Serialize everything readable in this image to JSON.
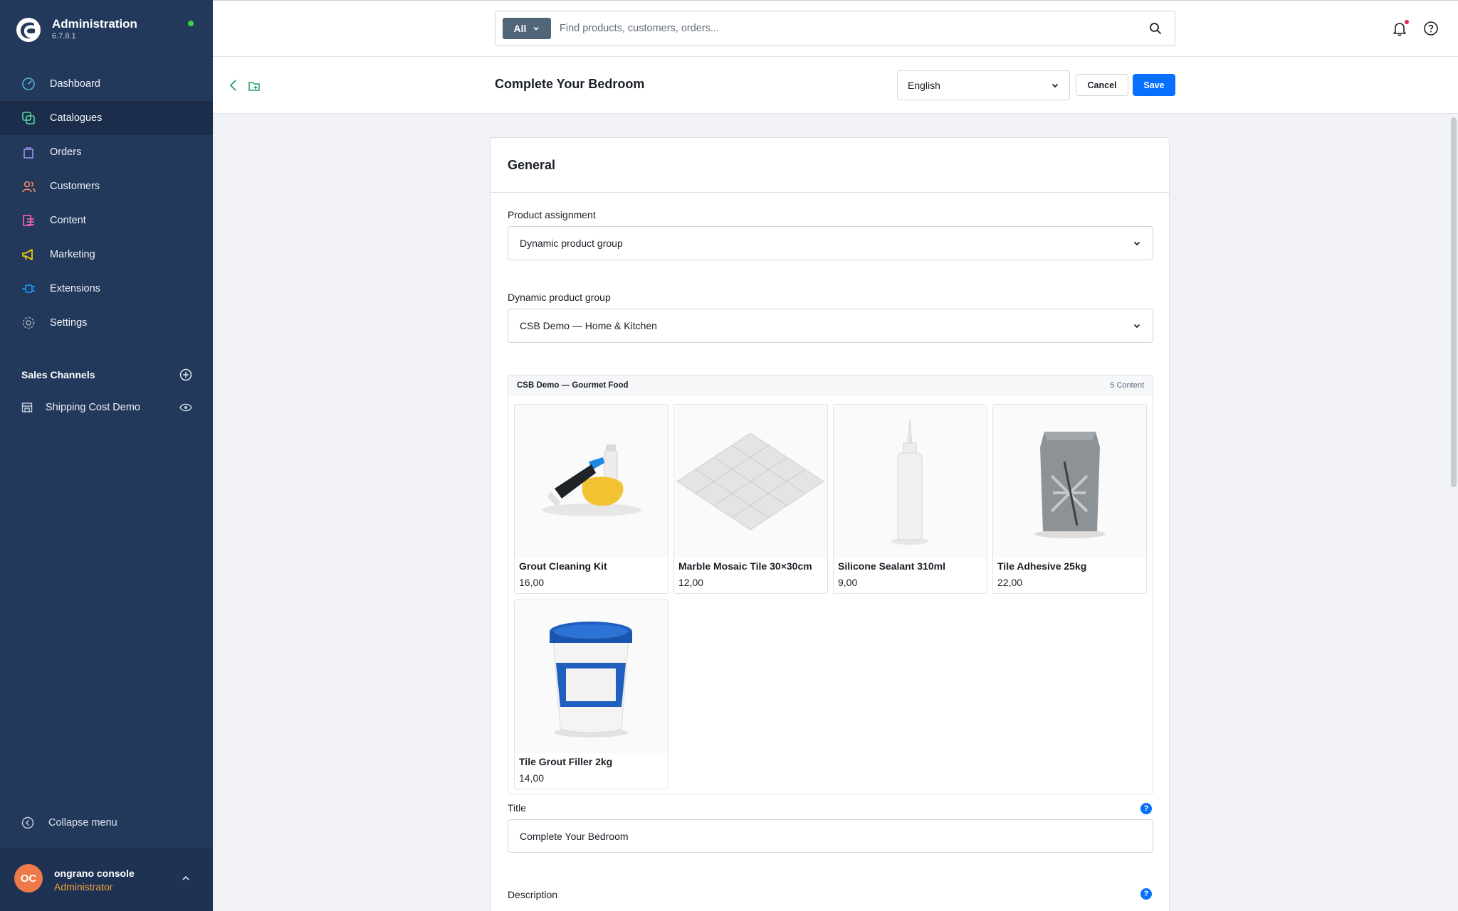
{
  "app": {
    "title": "Administration",
    "version": "6.7.8.1"
  },
  "nav": [
    {
      "label": "Dashboard",
      "icon": "dashboard-icon",
      "color": "#56b3d9"
    },
    {
      "label": "Catalogues",
      "icon": "catalogues-icon",
      "color": "#57d9a3",
      "active": true
    },
    {
      "label": "Orders",
      "icon": "orders-icon",
      "color": "#a092f0"
    },
    {
      "label": "Customers",
      "icon": "customers-icon",
      "color": "#f88962"
    },
    {
      "label": "Content",
      "icon": "content-icon",
      "color": "#ff68b4"
    },
    {
      "label": "Marketing",
      "icon": "marketing-icon",
      "color": "#ffd700"
    },
    {
      "label": "Extensions",
      "icon": "extensions-icon",
      "color": "#189eff"
    },
    {
      "label": "Settings",
      "icon": "settings-icon",
      "color": "#9aa8b5"
    }
  ],
  "sales_channels": {
    "heading": "Sales Channels",
    "items": [
      {
        "label": "Shipping Cost Demo"
      }
    ]
  },
  "collapse_label": "Collapse menu",
  "user": {
    "initials": "OC",
    "name": "ongrano console",
    "role": "Administrator"
  },
  "search": {
    "type_label": "All",
    "placeholder": "Find products, customers, orders..."
  },
  "smartbar": {
    "title": "Complete Your Bedroom",
    "language": "English",
    "cancel_label": "Cancel",
    "save_label": "Save"
  },
  "card": {
    "title": "General",
    "product_assignment": {
      "label": "Product assignment",
      "value": "Dynamic product group"
    },
    "dynamic_group": {
      "label": "Dynamic product group",
      "value": "CSB Demo — Home & Kitchen"
    },
    "preview": {
      "title": "CSB Demo — Gourmet Food",
      "count": "5 Content",
      "products": [
        {
          "name": "Grout Cleaning Kit",
          "price": "16,00"
        },
        {
          "name": "Marble Mosaic Tile 30×30cm",
          "price": "12,00"
        },
        {
          "name": "Silicone Sealant 310ml",
          "price": "9,00"
        },
        {
          "name": "Tile Adhesive 25kg",
          "price": "22,00"
        },
        {
          "name": "Tile Grout Filler 2kg",
          "price": "14,00"
        }
      ]
    },
    "title_field": {
      "label": "Title",
      "value": "Complete Your Bedroom",
      "help": "?"
    },
    "description_field": {
      "label": "Description",
      "help": "?"
    }
  }
}
